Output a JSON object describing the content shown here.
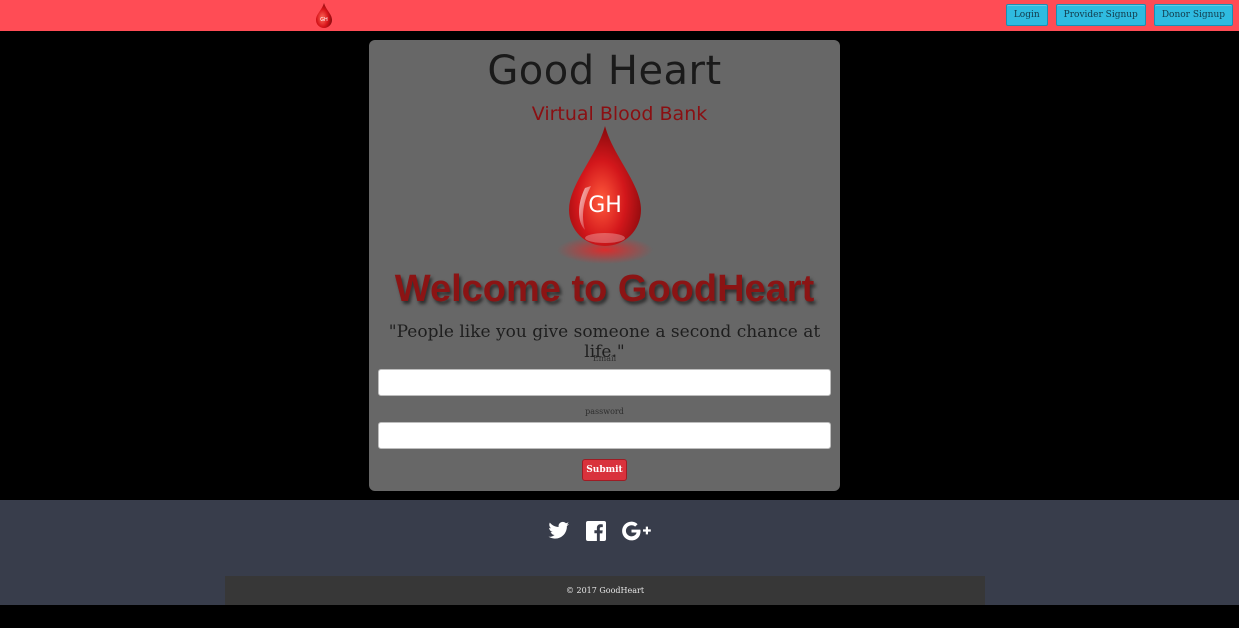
{
  "navbar": {
    "bg_color": "#ff4c55",
    "logo_icon": "blood-drop-icon",
    "logo_text": "GH",
    "buttons": [
      {
        "label": "Login"
      },
      {
        "label": "Provider Signup"
      },
      {
        "label": "Donor Signup"
      }
    ]
  },
  "card": {
    "brand_title": "Good Heart",
    "brand_subtitle": "Virtual Blood Bank",
    "drop_text": "GH",
    "welcome": "Welcome to GoodHeart",
    "quote": "\"People like you give someone a second chance at life.\"",
    "email_label": "Email",
    "email_value": "",
    "password_label": "password",
    "password_value": "",
    "submit_label": "Submit"
  },
  "footer": {
    "social_icons": [
      "twitter-icon",
      "facebook-icon",
      "google-plus-icon"
    ],
    "copyright": "© 2017 GoodHeart"
  },
  "colors": {
    "accent": "#ff4c55",
    "nav_button": "#2fbbe0",
    "submit": "#d9323c",
    "footer": "#383d4b"
  }
}
